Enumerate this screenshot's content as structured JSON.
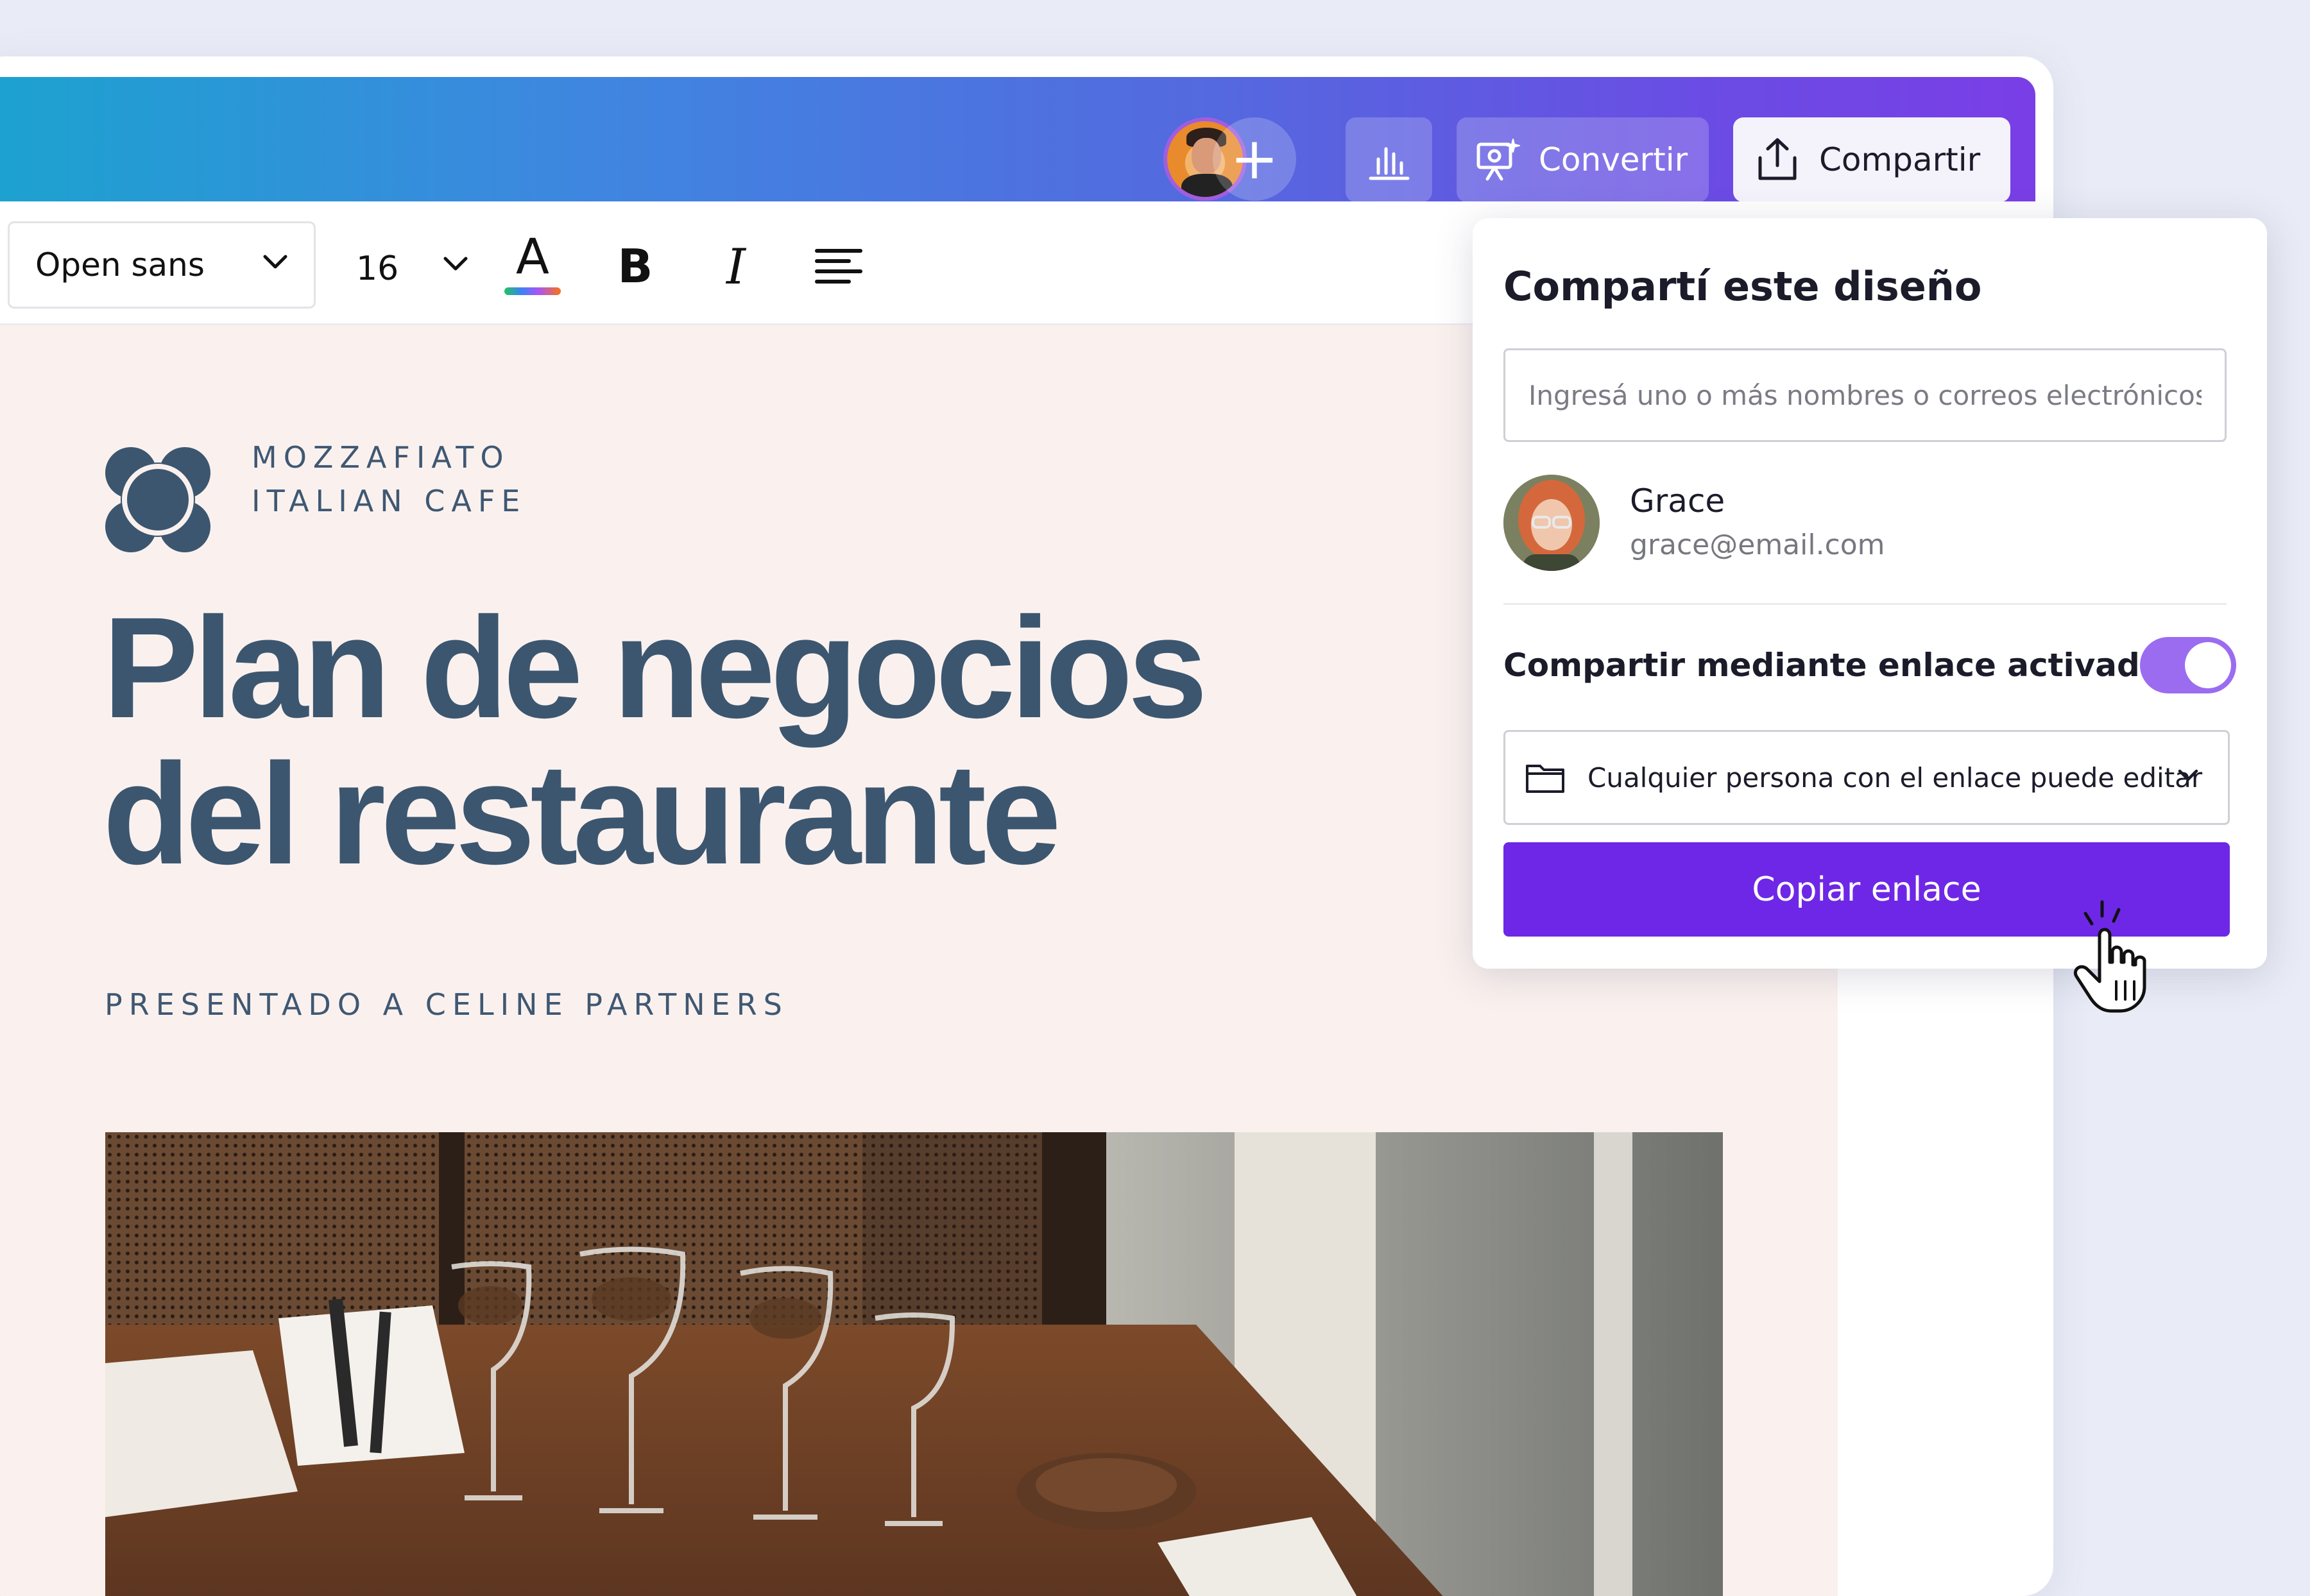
{
  "header": {
    "convert_label": "Convertir",
    "share_label": "Compartir",
    "add_label": "+"
  },
  "toolbar": {
    "font_family": "Open sans",
    "font_size": "16"
  },
  "document": {
    "brand_line1": "MOZZAFIATO",
    "brand_line2": "ITALIAN CAFE",
    "title_line1": "Plan de negocios",
    "title_line2": "del restaurante",
    "subtitle": "PRESENTADO A CELINE PARTNERS"
  },
  "share_panel": {
    "title": "Compartí este diseño",
    "email_placeholder": "Ingresá uno o más nombres o correos electrónicos",
    "user": {
      "name": "Grace",
      "email": "grace@email.com"
    },
    "link_sharing_label": "Compartir mediante enlace activado",
    "link_sharing_enabled": true,
    "permission": "Cualquier persona con el enlace puede editar",
    "copy_button": "Copiar enlace"
  },
  "colors": {
    "accent": "#6e27e6",
    "toggle": "#9b6cf0",
    "text_dark": "#3c5670",
    "doc_bg": "#faf1ee"
  },
  "icons": [
    "plus-icon",
    "bar-chart-icon",
    "convert-presentation-icon",
    "upload-icon",
    "chevron-down-icon",
    "text-color-icon",
    "bold-icon",
    "italic-icon",
    "align-left-icon",
    "folder-icon",
    "hand-cursor-icon"
  ]
}
